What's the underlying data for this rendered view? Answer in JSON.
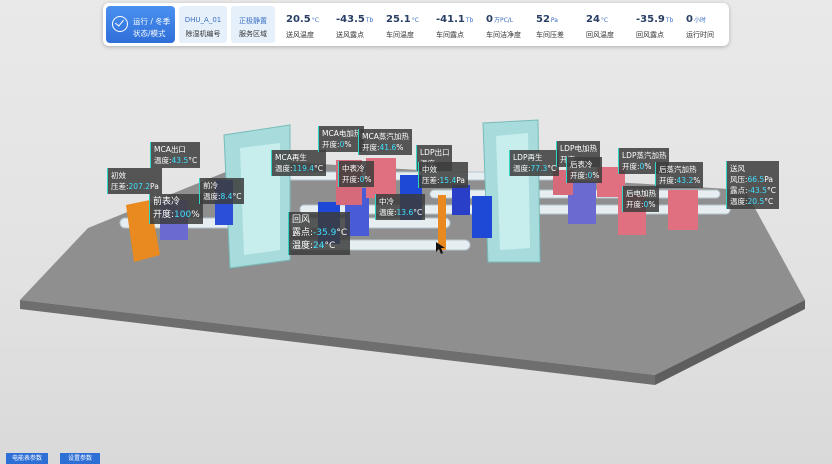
{
  "topbar": {
    "mode": {
      "line1": "运行 / 冬季",
      "line2": "状态/模式"
    },
    "unit": {
      "value": "DHU_A_01",
      "label": "除湿机编号"
    },
    "area": {
      "value": "正极静置",
      "label": "服务区域"
    },
    "metrics": [
      {
        "value": "20.5",
        "unit": "°C",
        "label": "送风温度"
      },
      {
        "value": "-43.5",
        "unit": "Tb",
        "label": "送风露点"
      },
      {
        "value": "25.1",
        "unit": "°C",
        "label": "车间温度"
      },
      {
        "value": "-41.1",
        "unit": "Tb",
        "label": "车间露点"
      },
      {
        "value": "0",
        "unit": "万PC/L",
        "label": "车间洁净度"
      },
      {
        "value": "52",
        "unit": "Pa",
        "label": "车间压差"
      },
      {
        "value": "24",
        "unit": "°C",
        "label": "回风温度"
      },
      {
        "value": "-35.9",
        "unit": "Tb",
        "label": "回风露点"
      },
      {
        "value": "0",
        "unit": "小时",
        "label": "运行时间"
      }
    ]
  },
  "labels": {
    "chuxiao": {
      "title": "初效",
      "k1": "压差:",
      "v1": "207.2",
      "u1": "Pa"
    },
    "qianbiaoleng": {
      "title": "前表冷",
      "k1": "开度:",
      "v1": "100",
      "u1": "%"
    },
    "mca_out": {
      "title": "MCA出口",
      "k1": "温度:",
      "v1": "43.5",
      "u1": "°C"
    },
    "qianleng": {
      "title": "前冷",
      "k1": "温度:",
      "v1": "8.4",
      "u1": "°C"
    },
    "mca_regen": {
      "title": "MCA再生",
      "k1": "温度:",
      "v1": "119.4",
      "u1": "°C"
    },
    "mca_elec": {
      "title": "MCA电加热",
      "k1": "开度:",
      "v1": "0",
      "u1": "%"
    },
    "mca_steam": {
      "title": "MCA蒸汽加热",
      "k1": "开度:",
      "v1": "41.6",
      "u1": "%"
    },
    "huifeng": {
      "title": "回风",
      "k1": "露点:",
      "v1": "-35.9",
      "u1": "°C",
      "k2": "温度:",
      "v2": "24",
      "u2": "°C"
    },
    "zhongbiaoleng": {
      "title": "中表冷",
      "k1": "开度:",
      "v1": "0",
      "u1": "%"
    },
    "zhongleng": {
      "title": "中冷",
      "k1": "温度:",
      "v1": "13.6",
      "u1": "°C"
    },
    "ldp_out": {
      "title": "LDP出口",
      "k1": "温度:",
      "v1": "",
      "u1": ""
    },
    "zhongxiao": {
      "title": "中效",
      "k1": "压差:",
      "v1": "15.4",
      "u1": "Pa"
    },
    "ldp_regen": {
      "title": "LDP再生",
      "k1": "温度:",
      "v1": "77.3",
      "u1": "°C"
    },
    "ldp_elec": {
      "title": "LDP电加热",
      "k1": "开度:",
      "v1": "",
      "u1": ""
    },
    "houbiaoleng": {
      "title": "后表冷",
      "k1": "开度:",
      "v1": "0",
      "u1": "%"
    },
    "ldp_steam": {
      "title": "LDP蒸汽加热",
      "k1": "开度:",
      "v1": "0",
      "u1": "%"
    },
    "hou_steam": {
      "title": "后蒸汽加热",
      "k1": "开度:",
      "v1": "43.2",
      "u1": "%"
    },
    "hou_elec": {
      "title": "后电加热",
      "k1": "开度:",
      "v1": "0",
      "u1": "%"
    },
    "songfeng": {
      "title": "送风",
      "k1": "风压:",
      "v1": "66.5",
      "u1": "Pa",
      "k2": "露点:",
      "v2": "-43.5",
      "u2": "°C",
      "k3": "温度:",
      "v3": "20.5",
      "u3": "°C"
    }
  },
  "buttons": {
    "meter": "电能表参数",
    "settings": "设置参数"
  }
}
